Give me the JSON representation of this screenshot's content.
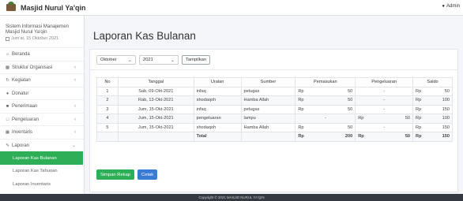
{
  "app": {
    "brand": "Masjid Nurul Ya'qin",
    "user": "Admin",
    "user_icon": "user-icon",
    "brand_icon": "mosque-logo"
  },
  "sidebar": {
    "system_name": "Sistem Informasi Manajemen Masjid Nurul Ya'qin",
    "date": "Jum'at, 15 Oktober 2021",
    "items": [
      {
        "label": "Beranda",
        "icon": "home-icon",
        "has_caret": false
      },
      {
        "label": "Struktur Organisasi",
        "icon": "sitemap-icon",
        "has_caret": true
      },
      {
        "label": "Kegiatan",
        "icon": "refresh-icon",
        "has_caret": true
      },
      {
        "label": "Donatur",
        "icon": "users-icon",
        "has_caret": false
      },
      {
        "label": "Penerimaan",
        "icon": "folder-icon",
        "has_caret": true
      },
      {
        "label": "Pengeluaran",
        "icon": "folder-open-icon",
        "has_caret": true
      },
      {
        "label": "Inventaris",
        "icon": "table-icon",
        "has_caret": true
      },
      {
        "label": "Laporan",
        "icon": "edit-icon",
        "has_caret": true
      }
    ],
    "submenu": [
      {
        "label": "Laporan Kas Bulanan",
        "active": true
      },
      {
        "label": "Laporan Kas Tahunan",
        "active": false
      },
      {
        "label": "Laporan Inventaris",
        "active": false
      }
    ]
  },
  "page": {
    "title": "Laporan Kas Bulanan"
  },
  "filters": {
    "month": "Oktober",
    "year": "2021",
    "button": "Tampilkan"
  },
  "table": {
    "headers": [
      "No",
      "Tanggal",
      "Uraian",
      "Sumber",
      "Pemasukan",
      "Pengeluaran",
      "Saldo"
    ],
    "rows": [
      {
        "no": "1",
        "tanggal": "Sab, 09-Okt-2021",
        "uraian": "infaq",
        "sumber": "petugas",
        "pemasukan_cur": "Rp",
        "pemasukan": "50",
        "pengeluaran_cur": "",
        "pengeluaran": "-",
        "saldo_cur": "Rp",
        "saldo": "50"
      },
      {
        "no": "2",
        "tanggal": "Rab, 13-Okt-2021",
        "uraian": "shodaqoh",
        "sumber": "Hamba Allah",
        "pemasukan_cur": "Rp",
        "pemasukan": "50",
        "pengeluaran_cur": "",
        "pengeluaran": "-",
        "saldo_cur": "Rp",
        "saldo": "100"
      },
      {
        "no": "3",
        "tanggal": "Jum, 15-Okt-2021",
        "uraian": "infaq",
        "sumber": "petugas",
        "pemasukan_cur": "Rp",
        "pemasukan": "50",
        "pengeluaran_cur": "",
        "pengeluaran": "-",
        "saldo_cur": "Rp",
        "saldo": "150"
      },
      {
        "no": "4",
        "tanggal": "Jum, 15-Okt-2021",
        "uraian": "pengeluaran",
        "sumber": "lampu",
        "pemasukan_cur": "",
        "pemasukan": "-",
        "pengeluaran_cur": "Rp",
        "pengeluaran": "50",
        "saldo_cur": "Rp",
        "saldo": "100"
      },
      {
        "no": "5",
        "tanggal": "Jum, 15-Okt-2021",
        "uraian": "shodaqoh",
        "sumber": "Hamba Allah",
        "pemasukan_cur": "Rp",
        "pemasukan": "50",
        "pengeluaran_cur": "",
        "pengeluaran": "-",
        "saldo_cur": "Rp",
        "saldo": "150"
      }
    ],
    "total": {
      "label": "Total",
      "pemasukan_cur": "Rp",
      "pemasukan": "200",
      "pengeluaran_cur": "Rp",
      "pengeluaran": "50",
      "saldo_cur": "Rp",
      "saldo": "150"
    }
  },
  "actions": {
    "save": "Simpan Rekap",
    "print": "Cetak"
  },
  "footer": {
    "text": "Copyright © 2021 MASJID NURUL YA'QIN"
  },
  "colors": {
    "accent_green": "#2eae57",
    "accent_blue": "#3a7bd5",
    "footer_bg": "#343a40"
  }
}
